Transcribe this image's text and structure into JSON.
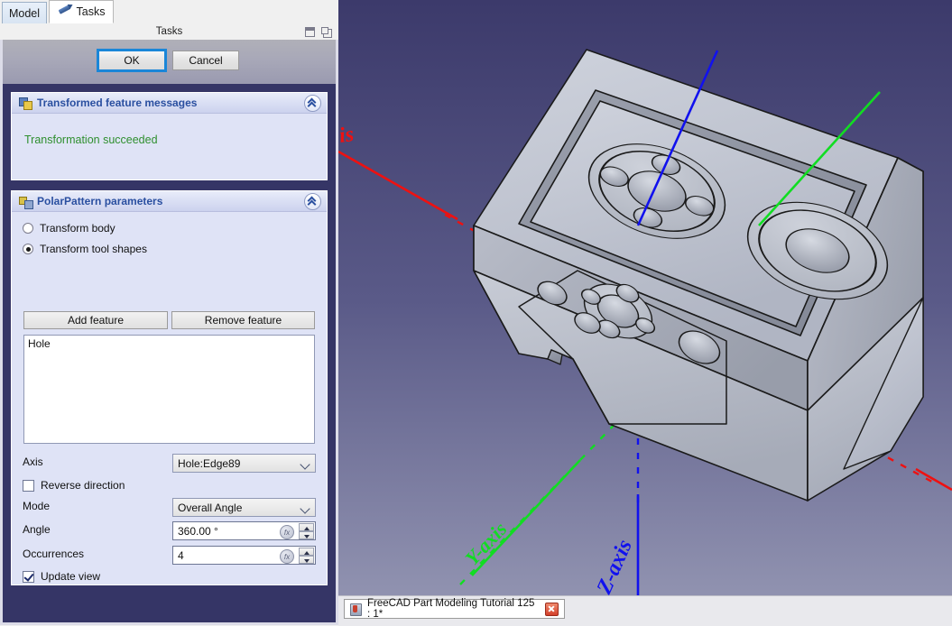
{
  "tabs": [
    {
      "label": "Model",
      "icon": "none",
      "active": false
    },
    {
      "label": "Tasks",
      "icon": "pencil-icon",
      "active": true
    }
  ],
  "dock": {
    "title": "Tasks",
    "float_icon": "float-icon",
    "close_icon": "undock-icon"
  },
  "dialog": {
    "ok_label": "OK",
    "cancel_label": "Cancel"
  },
  "messages_group": {
    "title": "Transformed feature messages",
    "icon": "transform-icon",
    "collapse_icon": "chevron-up-icon",
    "text": "Transformation succeeded",
    "text_color": "#2f8f2f"
  },
  "params_group": {
    "title": "PolarPattern parameters",
    "icon": "polar-pattern-icon",
    "collapse_icon": "chevron-up-icon",
    "radio_body": {
      "label": "Transform body",
      "checked": false
    },
    "radio_tool": {
      "label": "Transform tool shapes",
      "checked": true
    },
    "add_feature_label": "Add feature",
    "remove_feature_label": "Remove feature",
    "feature_list": [
      "Hole"
    ],
    "axis": {
      "label": "Axis",
      "value": "Hole:Edge89"
    },
    "reverse": {
      "label": "Reverse direction",
      "checked": false
    },
    "mode": {
      "label": "Mode",
      "value": "Overall Angle"
    },
    "angle": {
      "label": "Angle",
      "value": "360.00 °",
      "expression_icon": "fx-icon"
    },
    "occurrences": {
      "label": "Occurrences",
      "value": "4",
      "expression_icon": "fx-icon"
    },
    "update_view": {
      "label": "Update view",
      "checked": true
    }
  },
  "viewport": {
    "axis_labels": {
      "x": "is",
      "y": "Y-axis",
      "z": "Z-axis"
    },
    "colors": {
      "x_axis": "#ee1111",
      "y_axis": "#11dd22",
      "z_axis": "#1111ee",
      "bg_top": "#3c3a6b",
      "bg_bottom": "#9698b4",
      "part_fill": "#c3c7d2"
    }
  },
  "document_tab": {
    "label": "FreeCAD Part Modeling Tutorial 125 : 1*",
    "icon": "freecad-doc-icon",
    "close_icon": "close-icon"
  }
}
